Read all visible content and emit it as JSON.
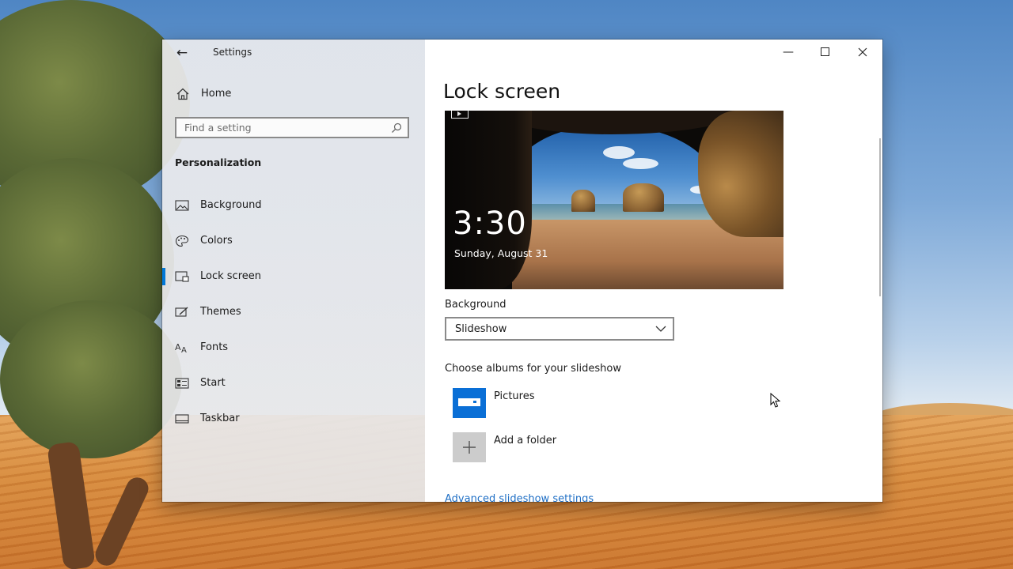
{
  "window": {
    "title": "Settings",
    "back_icon": "back-arrow-icon",
    "controls": {
      "minimize_icon": "minimize-icon",
      "maximize_icon": "maximize-icon",
      "close_icon": "close-icon"
    }
  },
  "nav": {
    "home": {
      "label": "Home",
      "icon": "home-icon"
    },
    "search": {
      "placeholder": "Find a setting",
      "icon": "search-icon"
    },
    "section_title": "Personalization",
    "items": [
      {
        "label": "Background",
        "icon": "picture-icon",
        "selected": false
      },
      {
        "label": "Colors",
        "icon": "palette-icon",
        "selected": false
      },
      {
        "label": "Lock screen",
        "icon": "lock-screen-icon",
        "selected": true
      },
      {
        "label": "Themes",
        "icon": "themes-icon",
        "selected": false
      },
      {
        "label": "Fonts",
        "icon": "fonts-icon",
        "selected": false
      },
      {
        "label": "Start",
        "icon": "start-icon",
        "selected": false
      },
      {
        "label": "Taskbar",
        "icon": "taskbar-icon",
        "selected": false
      }
    ]
  },
  "main": {
    "title": "Lock screen",
    "preview": {
      "time": "3:30",
      "date": "Sunday, August 31",
      "badge_icon": "slideshow-icon"
    },
    "background_label": "Background",
    "background_value": "Slideshow",
    "albums_label": "Choose albums for your slideshow",
    "albums": [
      {
        "label": "Pictures",
        "icon": "pictures-folder-icon"
      },
      {
        "label": "Add a folder",
        "icon": "plus-icon"
      }
    ],
    "advanced_link": "Advanced slideshow settings"
  },
  "colors": {
    "accent": "#0078d7",
    "link": "#1f6fc5",
    "tile_blue": "#0a6fd6",
    "tile_gray": "#cccccc"
  }
}
